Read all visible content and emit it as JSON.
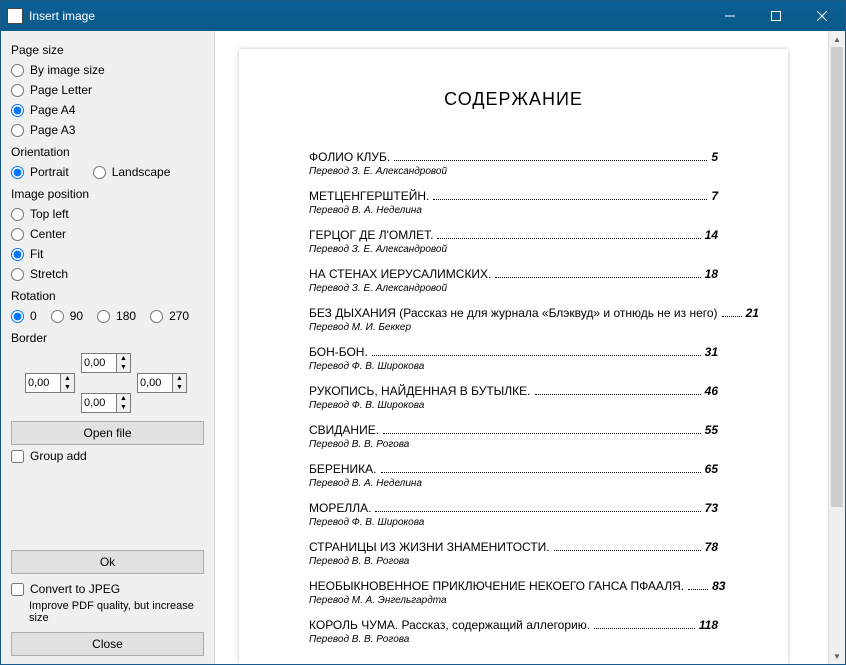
{
  "titlebar": {
    "title": "Insert image"
  },
  "sidebar": {
    "page_size": {
      "label": "Page size",
      "options": [
        "By image size",
        "Page Letter",
        "Page A4",
        "Page A3"
      ],
      "selected": 2
    },
    "orientation": {
      "label": "Orientation",
      "options": [
        "Portrait",
        "Landscape"
      ],
      "selected": 0
    },
    "image_position": {
      "label": "Image position",
      "options": [
        "Top left",
        "Center",
        "Fit",
        "Stretch"
      ],
      "selected": 2
    },
    "rotation": {
      "label": "Rotation",
      "options": [
        "0",
        "90",
        "180",
        "270"
      ],
      "selected": 0
    },
    "border": {
      "label": "Border",
      "top": "0,00",
      "left": "0,00",
      "right": "0,00",
      "bottom": "0,00"
    },
    "open_file": "Open file",
    "group_add": "Group add",
    "ok": "Ok",
    "convert_jpeg": "Convert to JPEG",
    "convert_hint": "Improve PDF quality, but increase size",
    "close": "Close"
  },
  "preview": {
    "title": "СОДЕРЖАНИЕ",
    "entries": [
      {
        "name": "ФОЛИО КЛУБ.",
        "page": "5",
        "sub": "Перевод З. Е. Александровой"
      },
      {
        "name": "МЕТЦЕНГЕРШТЕЙН.",
        "page": "7",
        "sub": "Перевод В. А. Неделина"
      },
      {
        "name": "ГЕРЦОГ ДЕ Л'ОМЛЕТ.",
        "page": "14",
        "sub": "Перевод З. Е. Александровой"
      },
      {
        "name": "НА СТЕНАХ ИЕРУСАЛИМСКИХ.",
        "page": "18",
        "sub": "Перевод З. Е. Александровой"
      },
      {
        "name": "БЕЗ ДЫХАНИЯ (Рассказ не для журнала «Блэквуд» и отнюдь не из него)",
        "page": "21",
        "sub": "Перевод М. И. Беккер"
      },
      {
        "name": "БОН-БОН.",
        "page": "31",
        "sub": "Перевод Ф. В. Широкова"
      },
      {
        "name": "РУКОПИСЬ, НАЙДЕННАЯ В БУТЫЛКЕ.",
        "page": "46",
        "sub": "Перевод Ф. В. Широкова"
      },
      {
        "name": "СВИДАНИЕ.",
        "page": "55",
        "sub": "Перевод В. В. Рогова"
      },
      {
        "name": "БЕРЕНИКА.",
        "page": "65",
        "sub": "Перевод В. А. Неделина"
      },
      {
        "name": "МОРЕЛЛА.",
        "page": "73",
        "sub": "Перевод Ф. В. Широкова"
      },
      {
        "name": "СТРАНИЦЫ ИЗ ЖИЗНИ ЗНАМЕНИТОСТИ.",
        "page": "78",
        "sub": "Перевод В. В. Рогова"
      },
      {
        "name": "НЕОБЫКНОВЕННОЕ ПРИКЛЮЧЕНИЕ НЕКОЕГО ГАНСА ПФААЛЯ.",
        "page": "83",
        "sub": "Перевод М. А. Энгельгардта"
      },
      {
        "name": "КОРОЛЬ ЧУМА. Рассказ, содержащий аллегорию.",
        "page": "118",
        "sub": "Перевод В. В. Рогова"
      }
    ]
  }
}
